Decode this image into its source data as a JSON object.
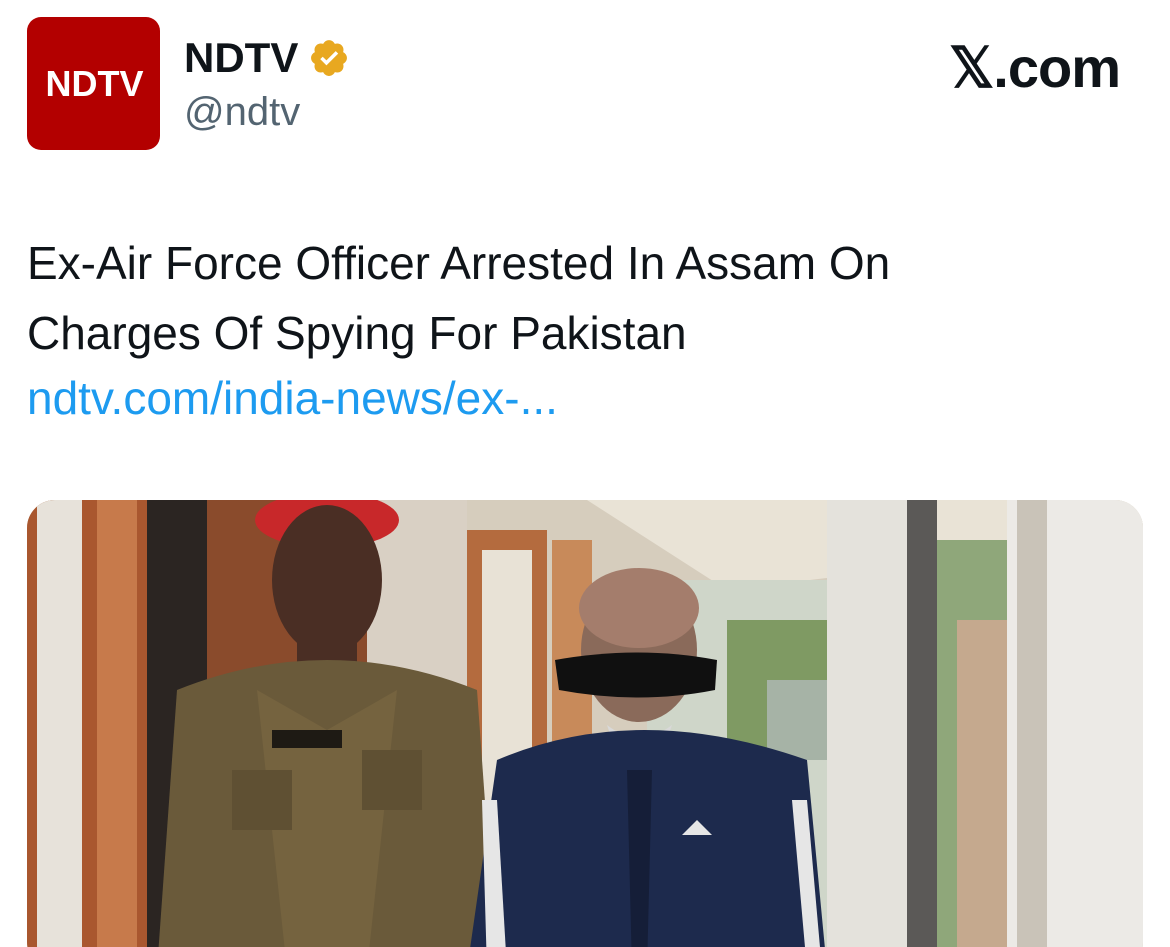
{
  "account": {
    "avatar_text": "NDTV",
    "display_name": "NDTV",
    "handle": "@ndtv",
    "verified_badge_color": "#e8a820"
  },
  "brand": {
    "label": "𝕏.com"
  },
  "tweet": {
    "text_lines": [
      "Ex-Air Force Officer Arrested In Assam On",
      "Charges Of Spying For Pakistan"
    ],
    "link": "ndtv.com/india-news/ex-..."
  },
  "colors": {
    "avatar_bg": "#b30000",
    "link": "#1d9bf0",
    "text": "#0f1419",
    "secondary_text": "#536471"
  }
}
